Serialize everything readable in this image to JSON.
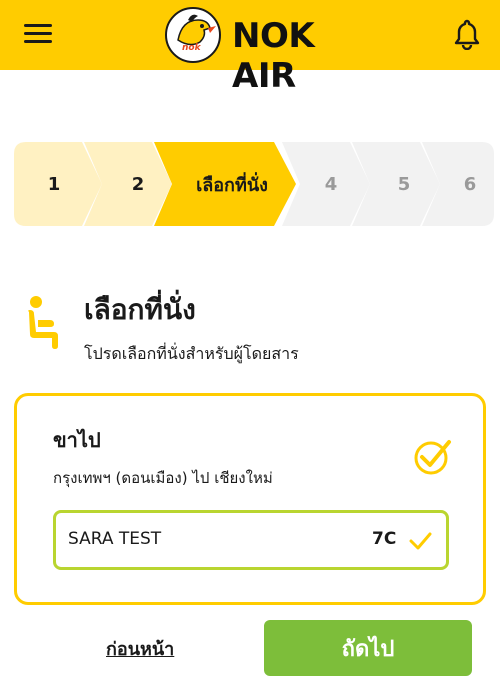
{
  "header": {
    "brand": "NOK AIR",
    "logo_text": "nok",
    "menu_icon": "hamburger-menu-icon",
    "bell_icon": "bell-icon",
    "bg_color": "#FFCC00"
  },
  "stepper": {
    "steps": [
      {
        "label": "1",
        "state": "completed"
      },
      {
        "label": "2",
        "state": "completed"
      },
      {
        "label": "เลือกที่นั่ง",
        "state": "active"
      },
      {
        "label": "4",
        "state": "upcoming"
      },
      {
        "label": "5",
        "state": "upcoming"
      },
      {
        "label": "6",
        "state": "upcoming"
      }
    ],
    "colors": {
      "completed": "#FFF1C2",
      "active": "#FFCC00",
      "upcoming": "#F2F2F2"
    }
  },
  "section": {
    "icon": "seat-icon",
    "title": "เลือกที่นั่ง",
    "subtitle": "โปรดเลือกที่นั่งสำหรับผู้โดยสาร"
  },
  "flight": {
    "direction_label": "ขาไป",
    "route": "กรุงเทพฯ (ดอนเมือง) ไป เชียงใหม่",
    "status_icon": "check-circle-icon",
    "passengers": [
      {
        "name": "SARA TEST",
        "seat": "7C"
      }
    ]
  },
  "footer": {
    "back_label": "ก่อนหน้า",
    "next_label": "ถัดไป",
    "next_color": "#7DBE3A"
  }
}
